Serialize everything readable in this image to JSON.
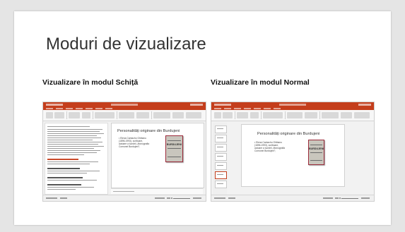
{
  "slide": {
    "title": "Moduri de vizualizare"
  },
  "captions": {
    "outline_view": "Vizualizare în modul Schiță",
    "normal_view": "Vizualizare în modul Normal"
  },
  "embedded_slide": {
    "title": "Personalități originare din Burdujeni",
    "bullet": "• Elena Cantacho Ghibanu (1896-1993), scriitoare, autoare a lucrării „Monografia Comunei Burdujeni”;",
    "book_cover_text": "BURDUJENI"
  },
  "colors": {
    "ribbon_accent": "#c43e1c",
    "page_background": "#e5e5e5",
    "slide_background": "#ffffff"
  }
}
